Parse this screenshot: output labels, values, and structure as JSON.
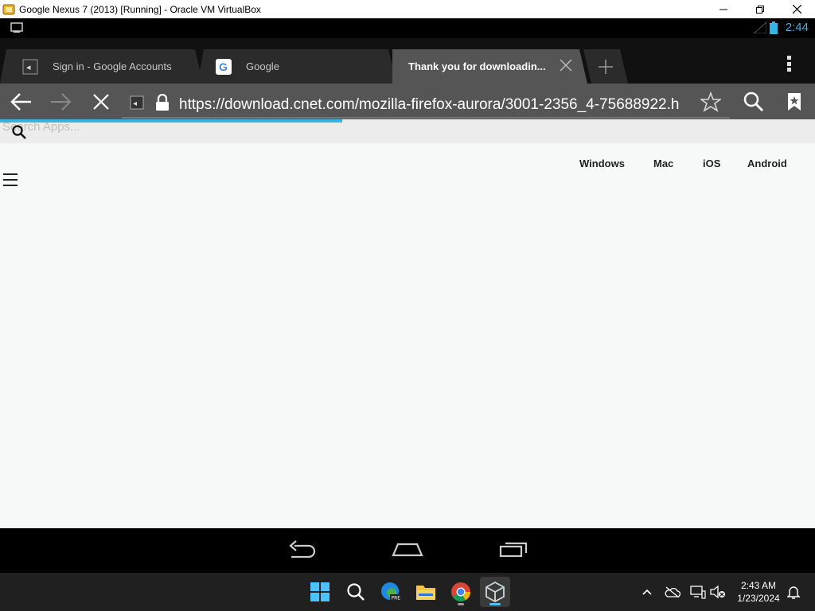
{
  "window": {
    "title": "Google Nexus 7 (2013) [Running] - Oracle VM VirtualBox"
  },
  "android_status": {
    "time": "2:44"
  },
  "tabs": [
    {
      "label": "Sign in - Google Accounts",
      "favicon": "cnet-favicon"
    },
    {
      "label": "Google",
      "favicon": "google-favicon"
    },
    {
      "label": "Thank you for downloadin...",
      "favicon": "none",
      "active": true
    }
  ],
  "toolbar": {
    "url": "https://download.cnet.com/mozilla-firefox-aurora/3001-2356_4-75688922.h",
    "load_progress": 0.42
  },
  "page": {
    "search_placeholder": "Search Apps...",
    "platform_nav": [
      "Windows",
      "Mac",
      "iOS",
      "Android"
    ]
  },
  "taskbar": {
    "apps": [
      "start-icon",
      "search-icon",
      "edge-icon",
      "file-explorer-icon",
      "chrome-icon",
      "virtualbox-icon"
    ],
    "time": "2:43 AM",
    "date": "1/23/2024"
  },
  "colors": {
    "accent": "#33b5e5",
    "toolbar": "#555555",
    "tabstrip": "#111111",
    "taskbar": "#202020"
  }
}
